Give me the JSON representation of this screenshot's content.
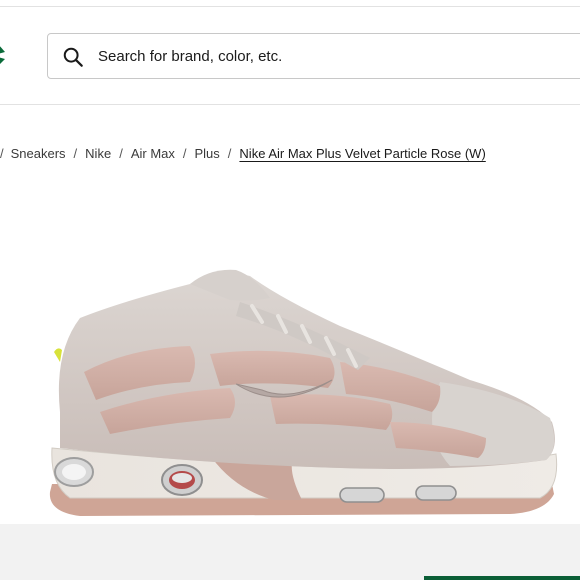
{
  "header": {
    "search": {
      "placeholder": "Search for brand, color, etc.",
      "value": ""
    }
  },
  "breadcrumb": {
    "items": [
      {
        "label": "Sneakers"
      },
      {
        "label": "Nike"
      },
      {
        "label": "Air Max"
      },
      {
        "label": "Plus"
      }
    ],
    "separator": "/",
    "current": "Nike Air Max Plus Velvet Particle Rose (W)"
  },
  "icons": {
    "search": "search-icon",
    "logo": "logo-icon"
  },
  "colors": {
    "brand_green": "#0b5e36",
    "text": "#1a1a1a",
    "border": "#c8c8c8"
  }
}
